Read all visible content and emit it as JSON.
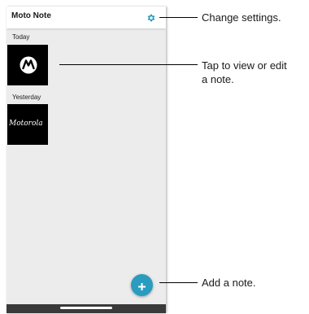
{
  "app": {
    "title": "Moto Note",
    "settings_icon": "gear-icon",
    "accent_color": "#2a9cbf"
  },
  "sections": [
    {
      "label": "Today",
      "note": {
        "type": "logo",
        "icon": "motorola-logo-icon"
      }
    },
    {
      "label": "Yesterday",
      "note": {
        "type": "handwriting",
        "text": "Motorola"
      }
    }
  ],
  "fab": {
    "icon": "plus-icon"
  },
  "callouts": {
    "settings": "Change settings.",
    "note_line1": "Tap to view or edit",
    "note_line2": "a note.",
    "add": "Add a note."
  }
}
